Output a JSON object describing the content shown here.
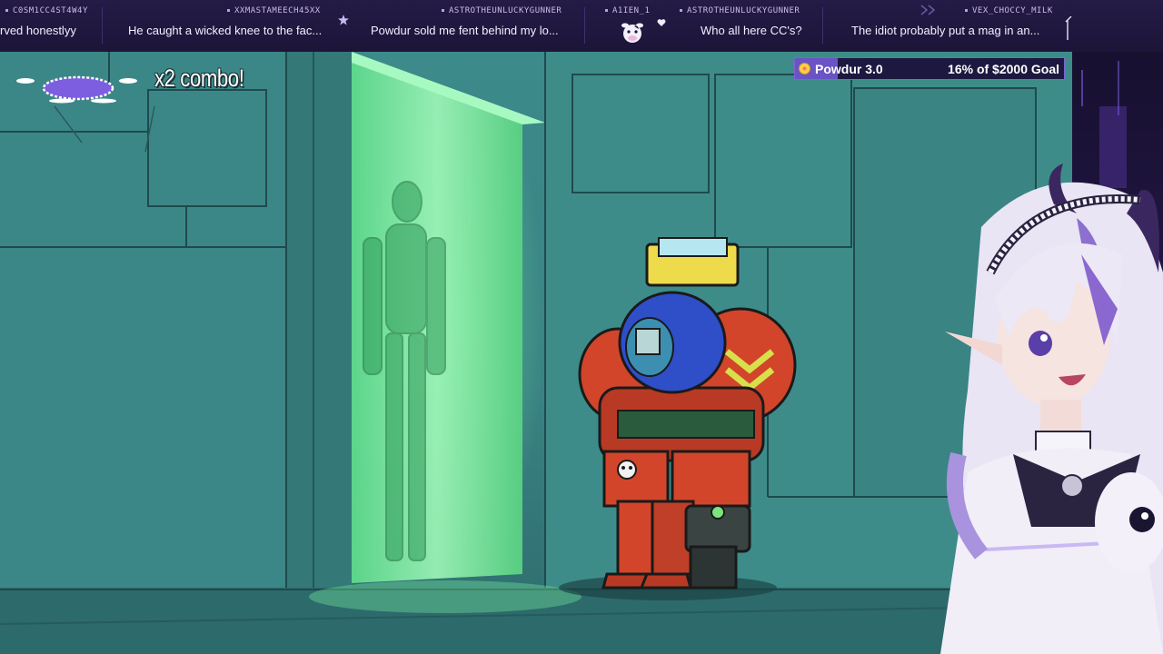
{
  "ticker": {
    "messages": [
      {
        "user": "C0SM1CC4ST4W4Y",
        "text": "rved honestlyy"
      },
      {
        "user": "XXMASTAMEECH45XX",
        "text": "He caught a wicked knee to the fac..."
      },
      {
        "user": "ASTROTHEUNLUCKYGUNNER",
        "text": "Powdur sold me fent behind my lo..."
      },
      {
        "user": "A1IEN_1",
        "text": ""
      },
      {
        "user": "ASTROTHEUNLUCKYGUNNER",
        "text": "Who all here CC's?"
      },
      {
        "user": "VEX_CHOCCY_MILK",
        "text": "The idiot probably put a mag in an..."
      }
    ]
  },
  "combo": {
    "label": "x2 combo!"
  },
  "goal": {
    "name": "Powdur 3.0",
    "progress_text": "16% of $2000 Goal",
    "percent": 16,
    "fill_color": "#6a53c4",
    "border_color": "#7f63d8"
  },
  "colors": {
    "ticker_bg": "#211944",
    "scene_wall": "#3c8a8a",
    "portal_green": "#6cf09a",
    "mech_red": "#d2452b",
    "mech_blue": "#2f4fc9"
  },
  "icons": {
    "ticker": [
      "star-icon",
      "heart-icon",
      "cow-icon",
      "arrow-icon",
      "pencil-icon"
    ],
    "goal": "coin-icon",
    "combo": "combo-badge-icon"
  }
}
